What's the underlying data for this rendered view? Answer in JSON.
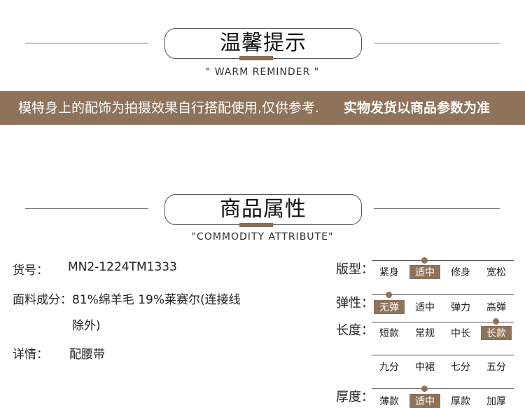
{
  "reminder": {
    "title": "温馨提示",
    "subtitle": "\" WARM REMINDER \""
  },
  "banner": {
    "text_normal": "模特身上的配饰为拍摄效果自行搭配使用,仅供参考.",
    "text_bold": "实物发货以商品参数为准"
  },
  "attributes_header": {
    "title": "商品属性",
    "subtitle": "\"COMMODITY ATTRIBUTE\""
  },
  "details": {
    "sku_label": "货号：",
    "sku_value": "MN2-1224TM1333",
    "fabric_label": "面料成分：",
    "fabric_value_line1": "81%绵羊毛 19%莱赛尔(连接线",
    "fabric_value_line2": "除外)",
    "detail_label": "详情：",
    "detail_value": "配腰带"
  },
  "attributes": {
    "fit": {
      "label": "版型：",
      "options": [
        "紧身",
        "适中",
        "修身",
        "宽松"
      ],
      "selected": "适中"
    },
    "elasticity": {
      "label": "弹性：",
      "options": [
        "无弹",
        "适中",
        "弹力",
        "高弹"
      ],
      "selected": "无弹"
    },
    "length": {
      "label": "长度：",
      "options": [
        "短款",
        "常规",
        "中长",
        "长款"
      ],
      "options_row2": [
        "九分",
        "中裙",
        "七分",
        "五分"
      ],
      "selected": "长款"
    },
    "thickness": {
      "label": "厚度：",
      "options": [
        "薄款",
        "适中",
        "厚款",
        "加厚"
      ],
      "selected": "适中"
    }
  },
  "colors": {
    "accent": "#8f725a",
    "text": "#222222"
  }
}
